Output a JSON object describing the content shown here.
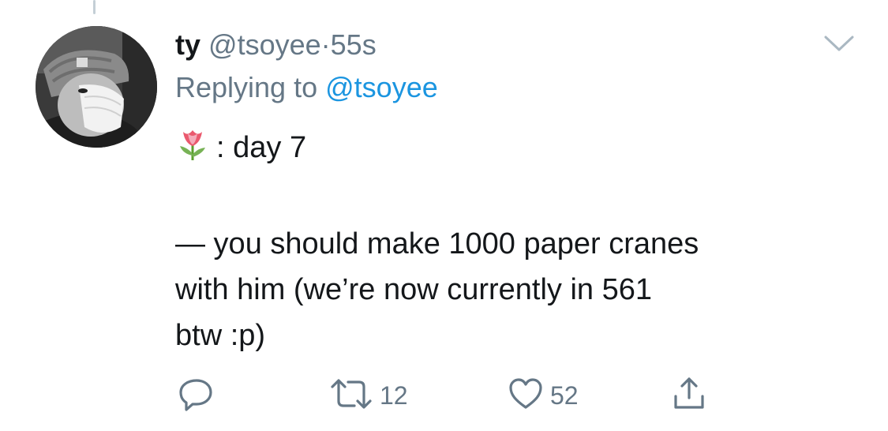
{
  "tweet": {
    "display_name": "ty",
    "handle": "@tsoyee",
    "separator": "·",
    "time": "55s",
    "replying_prefix": "Replying to",
    "replying_to": "@tsoyee",
    "text_line1": ": day 7",
    "text_lines": [
      "— you should make 1000 paper cranes",
      "with him (we’re now currently in 561",
      "btw :p)"
    ],
    "emoji": "tulip-icon"
  },
  "actions": {
    "reply": {
      "icon": "reply-icon"
    },
    "retweet": {
      "icon": "retweet-icon",
      "count": "12"
    },
    "like": {
      "icon": "heart-icon",
      "count": "52"
    },
    "share": {
      "icon": "share-icon"
    }
  },
  "menu": {
    "icon": "chevron-down-icon"
  },
  "colors": {
    "text_primary": "#14171a",
    "text_secondary": "#657786",
    "link": "#1b95e0",
    "thread_line": "#c4cfd6"
  }
}
